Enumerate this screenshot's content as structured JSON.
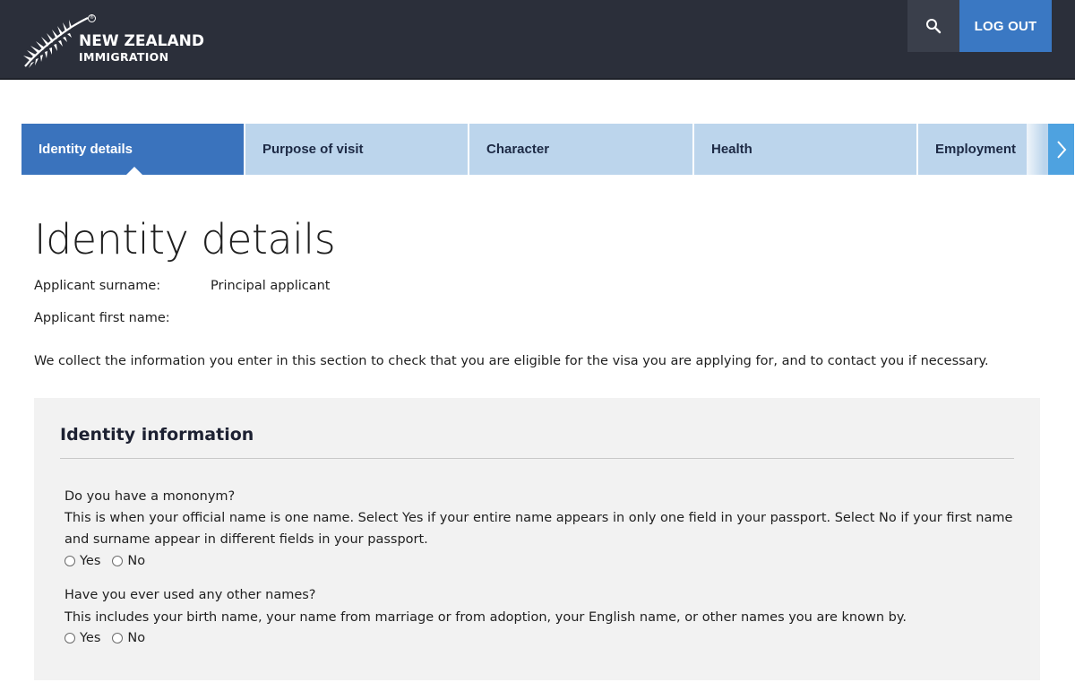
{
  "header": {
    "logo_line1": "NEW ZEALAND",
    "logo_line2": "IMMIGRATION",
    "logo_mark": "®",
    "search_icon": "search-icon",
    "logout_label": "LOG OUT",
    "colors": {
      "bar": "#2b2f3a",
      "logout": "#3a78c3"
    }
  },
  "tabs": [
    {
      "label": "Identity details",
      "active": true
    },
    {
      "label": "Purpose of visit",
      "active": false
    },
    {
      "label": "Character",
      "active": false
    },
    {
      "label": "Health",
      "active": false
    },
    {
      "label": "Employment",
      "active": false
    }
  ],
  "tab_next_icon": "chevron-right-icon",
  "main": {
    "title": "Identity details",
    "surname_label": "Applicant surname:",
    "surname_value": "Principal applicant",
    "firstname_label": "Applicant first name:",
    "firstname_value": "",
    "intro": "We collect the information you enter in this section to check that you are eligible for the visa you are applying for, and to contact you if necessary."
  },
  "section": {
    "title": "Identity information",
    "questions": [
      {
        "question": "Do you have a mononym?",
        "help": "This is when your official name is one name. Select Yes if your entire name appears in only one field in your passport. Select No if your first name and surname appear in different fields in your passport.",
        "options": [
          "Yes",
          "No"
        ]
      },
      {
        "question": "Have you ever used any other names?",
        "help": "This includes your birth name, your name from marriage or from adoption, your English name, or other names you are known by.",
        "options": [
          "Yes",
          "No"
        ]
      }
    ]
  }
}
